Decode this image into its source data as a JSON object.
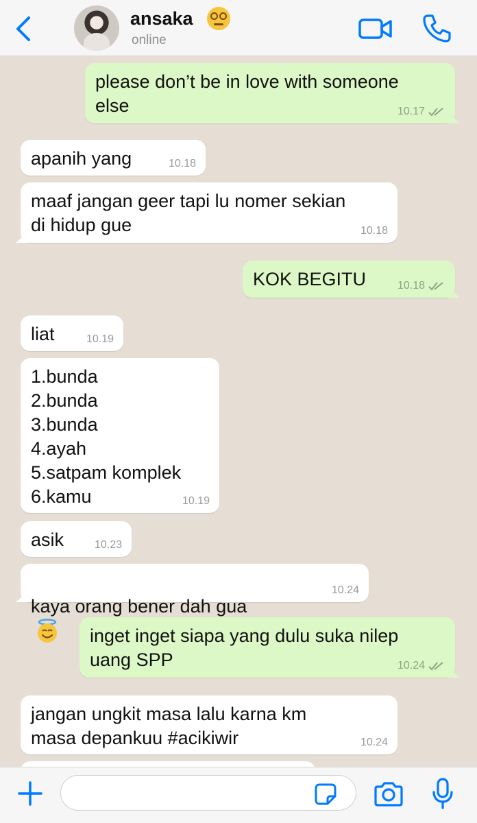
{
  "header": {
    "contact_name": "ansaka",
    "status": "online",
    "icons": {
      "back": "chevron-left-icon",
      "video": "video-call-icon",
      "call": "phone-icon",
      "name_emoji": "dizzy-face-emoji"
    },
    "accent_color": "#007aff"
  },
  "messages": [
    {
      "direction": "out",
      "text": "please don’t be in love with someone\nelse",
      "time": "10.17",
      "read": true
    },
    {
      "direction": "in",
      "text": "apanih yang",
      "time": "10.18"
    },
    {
      "direction": "in",
      "text": "maaf jangan geer tapi lu nomer sekian\ndi hidup gue",
      "time": "10.18"
    },
    {
      "direction": "out",
      "text": "KOK BEGITU",
      "time": "10.18",
      "read": true
    },
    {
      "direction": "in",
      "text": "liat",
      "time": "10.19"
    },
    {
      "direction": "in",
      "text": "1.bunda\n2.bunda\n3.bunda\n4.ayah\n5.satpam komplek\n6.kamu",
      "time": "10.19"
    },
    {
      "direction": "in",
      "text": "asik",
      "time": "10.23"
    },
    {
      "direction": "in",
      "text": "kaya orang bener dah gua",
      "emoji": "smiling-face-with-halo-emoji",
      "time": "10.24"
    },
    {
      "direction": "out",
      "text": "inget inget siapa yang dulu suka nilep\nuang SPP",
      "time": "10.24",
      "read": true
    },
    {
      "direction": "in",
      "text": "jangan ungkit masa lalu karna km\nmasa depankuu #acikiwir",
      "time": "10.24"
    }
  ],
  "composer": {
    "input_value": "",
    "icons": {
      "plus": "plus-icon",
      "sticker": "sticker-icon",
      "camera": "camera-icon",
      "mic": "microphone-icon"
    }
  },
  "colors": {
    "outgoing_bubble": "#dcf8c6",
    "incoming_bubble": "#ffffff",
    "chat_background": "#e6ded4",
    "read_ticks": "#8fa383"
  }
}
